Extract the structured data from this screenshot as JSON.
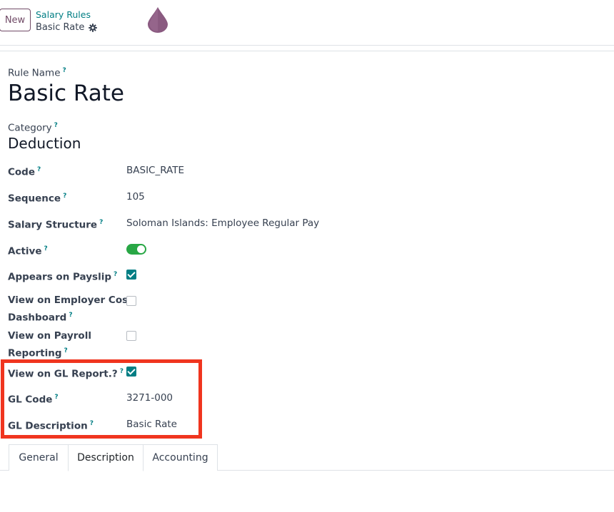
{
  "header": {
    "new_label": "New",
    "breadcrumb": "Salary Rules",
    "record_name": "Basic Rate",
    "gear_icon": "gear-icon",
    "drop_icon": "drop-icon",
    "drop_color": "#8a5a80"
  },
  "form": {
    "rule_name_label": "Rule Name",
    "rule_name": "Basic Rate",
    "category_label": "Category",
    "category": "Deduction",
    "help_mark": "?",
    "fields": {
      "code": {
        "label": "Code",
        "value": "BASIC_RATE"
      },
      "sequence": {
        "label": "Sequence",
        "value": "105"
      },
      "salary_structure": {
        "label": "Salary Structure",
        "value": "Soloman Islands: Employee Regular Pay"
      },
      "active": {
        "label": "Active",
        "value": true
      },
      "appears_on_payslip": {
        "label": "Appears on Payslip",
        "value": true
      },
      "view_employer_cost": {
        "label_line1": "View on Employer Cost",
        "label_line2": "Dashboard",
        "value": false
      },
      "view_payroll_reporting": {
        "label_line1": "View on Payroll",
        "label_line2": "Reporting",
        "value": false
      },
      "view_gl_report": {
        "label": "View on GL Report.?",
        "value": true
      },
      "gl_code": {
        "label": "GL Code",
        "value": "3271-000"
      },
      "gl_description": {
        "label": "GL Description",
        "value": "Basic Rate"
      }
    }
  },
  "tabs": [
    {
      "label": "General",
      "active": false
    },
    {
      "label": "Description",
      "active": true
    },
    {
      "label": "Accounting",
      "active": false
    }
  ],
  "colors": {
    "accent": "#017e84",
    "brand": "#714b67",
    "toggle_on": "#28a745",
    "highlight": "#f0351f"
  }
}
